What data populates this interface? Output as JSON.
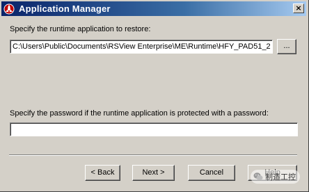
{
  "window": {
    "title": "Application Manager",
    "close_symbol": "×",
    "icon": "rockwell-app-manager-icon"
  },
  "restore": {
    "label": "Specify the runtime application to restore:",
    "path_value": "C:\\Users\\Public\\Documents\\RSView Enterprise\\ME\\Runtime\\HFY_PAD51_2",
    "browse_label": "..."
  },
  "password": {
    "label": "Specify the password if the runtime application is protected with a password:",
    "value": ""
  },
  "buttons": {
    "back": "< Back",
    "next": "Next >",
    "cancel": "Cancel",
    "help": "Help"
  },
  "watermark": {
    "text": "制造工控",
    "icon": "wechat-icon"
  },
  "colors": {
    "title_bar_start": "#0a246a",
    "title_bar_end": "#a6caf0",
    "dialog_face": "#d4d0c8"
  }
}
